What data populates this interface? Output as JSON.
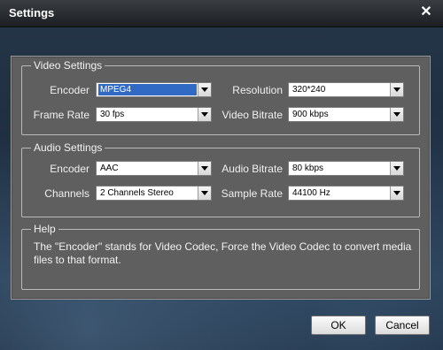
{
  "window": {
    "title": "Settings"
  },
  "video": {
    "legend": "Video Settings",
    "encoder_label": "Encoder",
    "encoder_value": "MPEG4",
    "resolution_label": "Resolution",
    "resolution_value": "320*240",
    "framerate_label": "Frame Rate",
    "framerate_value": "30 fps",
    "bitrate_label": "Video Bitrate",
    "bitrate_value": "900 kbps"
  },
  "audio": {
    "legend": "Audio Settings",
    "encoder_label": "Encoder",
    "encoder_value": "AAC",
    "bitrate_label": "Audio Bitrate",
    "bitrate_value": "80 kbps",
    "channels_label": "Channels",
    "channels_value": "2 Channels Stereo",
    "samplerate_label": "Sample Rate",
    "samplerate_value": "44100 Hz"
  },
  "help": {
    "legend": "Help",
    "text": "The \"Encoder\" stands for Video Codec, Force the Video Codec to convert media files to that format."
  },
  "buttons": {
    "ok": "OK",
    "cancel": "Cancel"
  }
}
